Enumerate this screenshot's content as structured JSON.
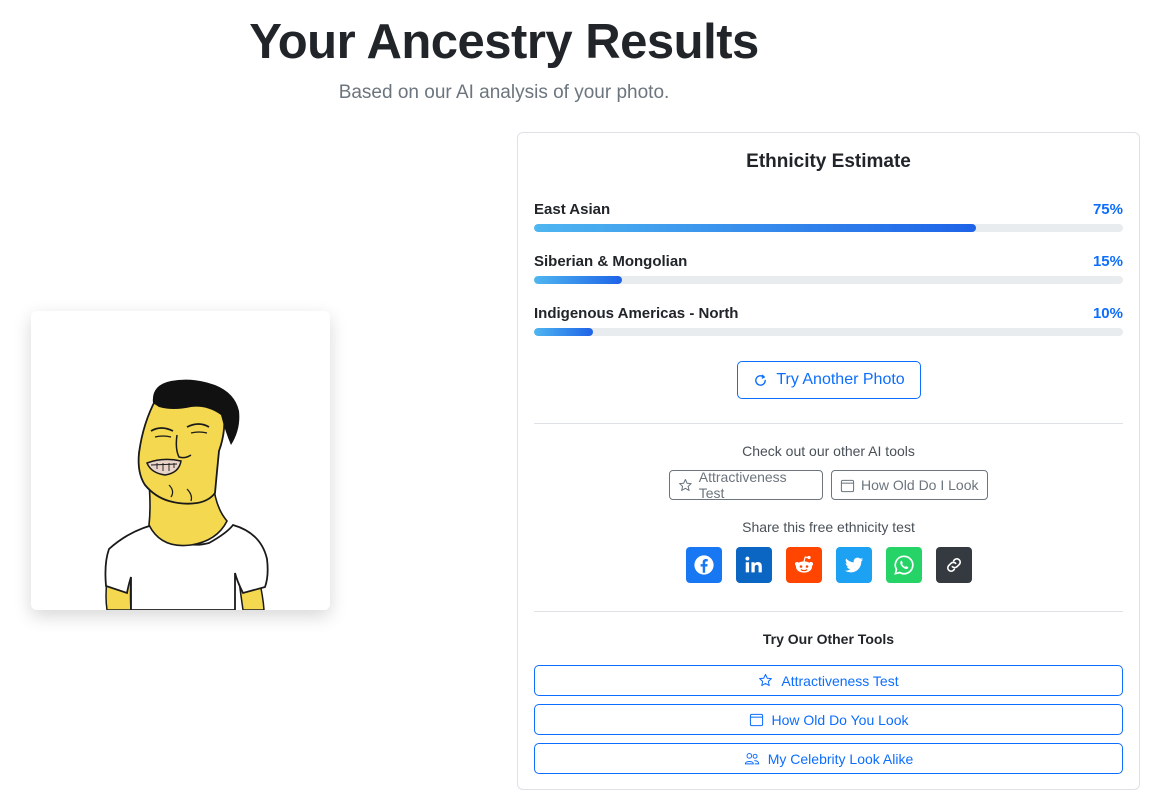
{
  "header": {
    "title": "Your Ancestry Results",
    "subtitle": "Based on our AI analysis of your photo."
  },
  "photo": {
    "alt": "Uploaded photo"
  },
  "results": {
    "title": "Ethnicity Estimate",
    "items": [
      {
        "label": "East Asian",
        "percent_label": "75%",
        "value": 75
      },
      {
        "label": "Siberian & Mongolian",
        "percent_label": "15%",
        "value": 15
      },
      {
        "label": "Indigenous Americas - North",
        "percent_label": "10%",
        "value": 10
      }
    ],
    "try_again_label": "Try Another Photo"
  },
  "other_tools": {
    "prompt": "Check out our other AI tools",
    "buttons": [
      {
        "label": "Attractiveness Test",
        "icon": "star-icon"
      },
      {
        "label": "How Old Do I Look",
        "icon": "calendar-icon"
      }
    ]
  },
  "share": {
    "prompt": "Share this free ethnicity test",
    "networks": [
      {
        "name": "facebook",
        "icon": "facebook-icon",
        "color": "#1877f2"
      },
      {
        "name": "linkedin",
        "icon": "linkedin-icon",
        "color": "#0a66c2"
      },
      {
        "name": "reddit",
        "icon": "reddit-icon",
        "color": "#ff4500"
      },
      {
        "name": "twitter",
        "icon": "twitter-icon",
        "color": "#1da1f2"
      },
      {
        "name": "whatsapp",
        "icon": "whatsapp-icon",
        "color": "#25d366"
      },
      {
        "name": "copy-link",
        "icon": "link-icon",
        "color": "#343a40"
      }
    ]
  },
  "tools": {
    "title": "Try Our Other Tools",
    "buttons": [
      {
        "label": "Attractiveness Test",
        "icon": "star-icon"
      },
      {
        "label": "How Old Do You Look",
        "icon": "calendar-icon"
      },
      {
        "label": "My Celebrity Look Alike",
        "icon": "people-icon"
      }
    ]
  },
  "colors": {
    "accent": "#0d6efd",
    "bar_start": "#4fb6f0",
    "bar_end": "#1e63e8",
    "track": "#e9ecef"
  }
}
